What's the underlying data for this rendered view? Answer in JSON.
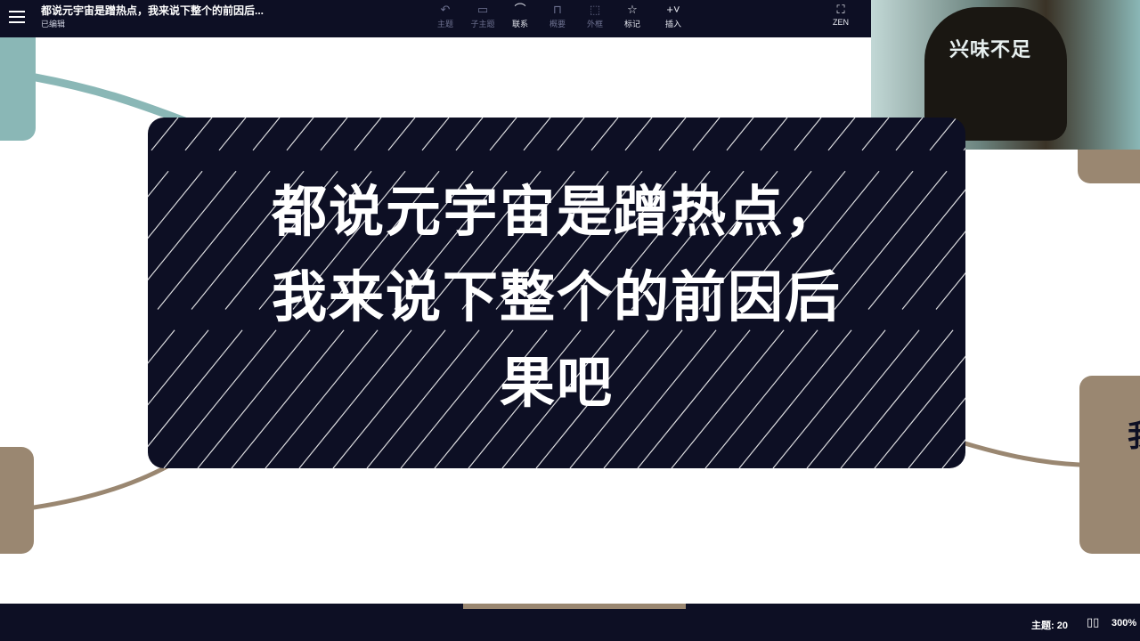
{
  "header": {
    "title": "都说元宇宙是蹭热点，我来说下整个的前因后...",
    "status": "已编辑",
    "tools": [
      {
        "icon": "↶",
        "label": "主题"
      },
      {
        "icon": "▭",
        "label": "子主题"
      },
      {
        "icon": "⌒",
        "label": "联系"
      },
      {
        "icon": "⊓",
        "label": "概要"
      },
      {
        "icon": "⬚",
        "label": "外框"
      },
      {
        "icon": "☆",
        "label": "标记"
      },
      {
        "icon": "+˅",
        "label": "插入"
      },
      {
        "icon": "⛶",
        "label": "ZEN"
      }
    ]
  },
  "video_caption": "兴味不足",
  "headline": {
    "line1": "都说元宇宙是蹭热点，",
    "line2": "我来说下整个的前因后",
    "line3": "果吧"
  },
  "side_node_glyph": "我",
  "footer": {
    "topic_count": "主题: 20",
    "zoom": "300%"
  },
  "colors": {
    "dark": "#0d0f24",
    "teal": "#8ab7b6",
    "brown": "#9a8771"
  }
}
